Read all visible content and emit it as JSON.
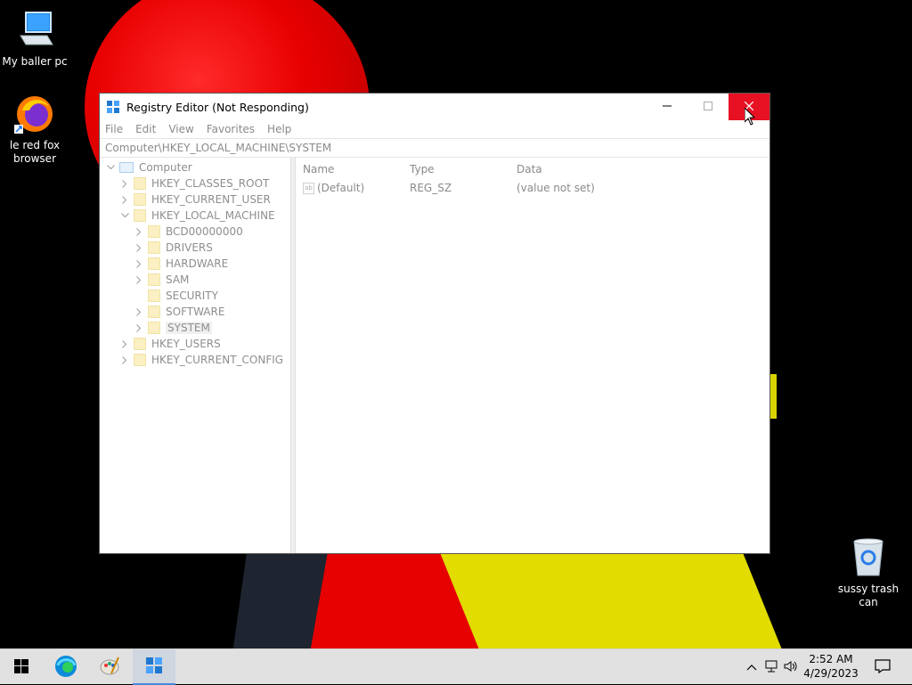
{
  "desktop": {
    "icons": [
      {
        "label": "My baller pc",
        "icon": "computer-icon"
      },
      {
        "label": "le red fox browser",
        "icon": "firefox-icon"
      },
      {
        "label": "sussy trash can",
        "icon": "recycle-bin-icon"
      }
    ]
  },
  "window": {
    "title": "Registry Editor (Not Responding)",
    "controls": {
      "minimize": "minimize-icon",
      "maximize": "maximize-icon",
      "close": "close-icon"
    },
    "close_color": "#e81123",
    "menu": [
      "File",
      "Edit",
      "View",
      "Favorites",
      "Help"
    ],
    "address": "Computer\\HKEY_LOCAL_MACHINE\\SYSTEM"
  },
  "tree": {
    "root": "Computer",
    "hives": [
      {
        "label": "HKEY_CLASSES_ROOT"
      },
      {
        "label": "HKEY_CURRENT_USER"
      },
      {
        "label": "HKEY_LOCAL_MACHINE",
        "expanded": true
      },
      {
        "label": "HKEY_USERS"
      },
      {
        "label": "HKEY_CURRENT_CONFIG"
      }
    ],
    "hklm_children": [
      "BCD00000000",
      "DRIVERS",
      "HARDWARE",
      "SAM",
      "SECURITY",
      "SOFTWARE",
      "SYSTEM"
    ],
    "selected": "SYSTEM"
  },
  "values_list": {
    "headers": {
      "name": "Name",
      "type": "Type",
      "data": "Data"
    },
    "rows": [
      {
        "name": "(Default)",
        "type": "REG_SZ",
        "data": "(value not set)"
      }
    ]
  },
  "taskbar": {
    "items": [
      "start-icon",
      "edge-icon",
      "paint-icon",
      "registry-editor-icon"
    ],
    "active": "registry-editor-icon",
    "time": "2:52 AM",
    "date": "4/29/2023"
  }
}
